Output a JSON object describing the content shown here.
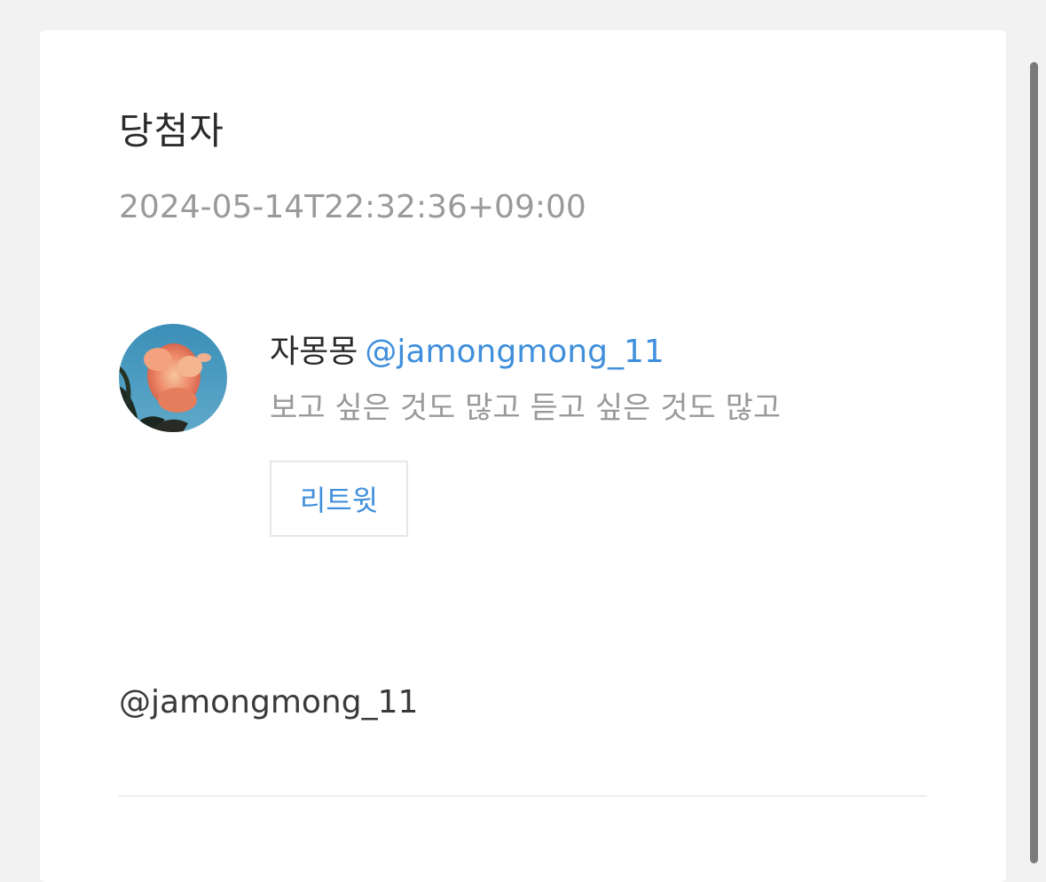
{
  "result": {
    "title": "당첨자",
    "timestamp": "2024-05-14T22:32:36+09:00"
  },
  "winner": {
    "display_name": "자몽몽",
    "handle": "@jamongmong_11",
    "bio": "보고 싶은 것도 많고 듣고 싶은 것도 많고",
    "avatar_icon": "profile-photo-pink-cloud-blue-sky",
    "retweet_label": "리트윗"
  },
  "summary": {
    "handle": "@jamongmong_11"
  },
  "colors": {
    "accent": "#3f8fdc",
    "muted_text": "#9a9a9a",
    "page_background": "#f2f2f2"
  }
}
